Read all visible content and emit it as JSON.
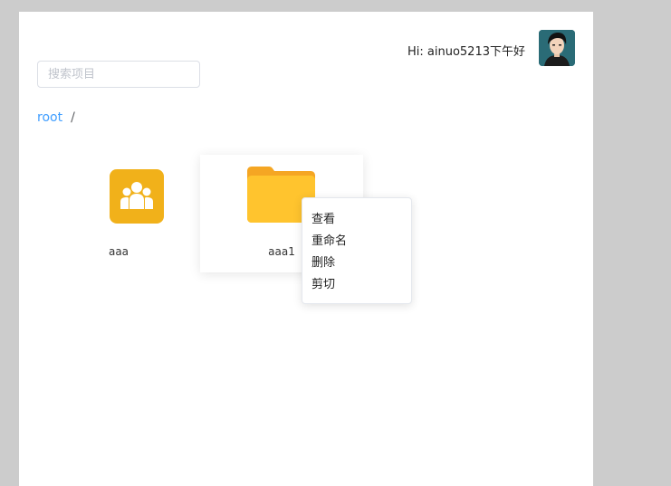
{
  "header": {
    "greeting": "Hi: ainuo5213下午好",
    "avatar_icon": "user-avatar-icon"
  },
  "search": {
    "placeholder": "搜索项目",
    "value": ""
  },
  "breadcrumb": {
    "root": "root",
    "separator": "/"
  },
  "items": [
    {
      "name": "aaa",
      "icon": "group-icon",
      "color": "#f1b11a"
    },
    {
      "name": "aaa1",
      "icon": "folder-icon",
      "color": "#ffc42e"
    }
  ],
  "context_menu": {
    "items": [
      "查看",
      "重命名",
      "删除",
      "剪切"
    ]
  },
  "colors": {
    "accent": "#409eff",
    "background": "#cccccc"
  }
}
